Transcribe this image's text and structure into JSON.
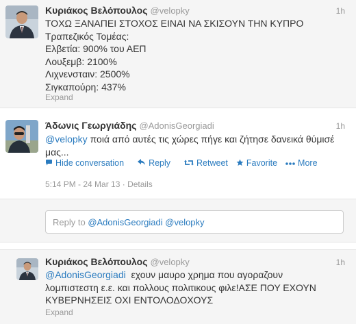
{
  "tweets": [
    {
      "name": "Κυριάκος Βελόπουλος",
      "handle": "@velopky",
      "time": "1h",
      "text": "ΤΟΧΩ ΞΑΝΑΠΕΙ ΣΤΟΧΟΣ ΕΙΝΑΙ ΝΑ ΣΚΙΣΟΥΝ ΤΗΝ ΚΥΠΡΟ\nΤραπεζικός Τομέας:\nΕλβετία: 900% του ΑΕΠ\nΛουξεμβ: 2100%\nΛιχνενσταιν: 2500%\nΣιγκαπούρη: 437%",
      "expand": "Expand"
    },
    {
      "name": "Άδωνις Γεωργιάδης",
      "handle": "@AdonisGeorgiadi",
      "time": "1h",
      "mention": "@velopky",
      "text": " ποιά από αυτές τις χώρες πήγε και ζήτησε δανεικά θύμισέ μας...",
      "actions": {
        "hide": "Hide conversation",
        "reply": "Reply",
        "retweet": "Retweet",
        "favorite": "Favorite",
        "more": "More"
      },
      "timestamp": "5:14 PM - 24 Mar 13",
      "details": "Details"
    },
    {
      "name": "Κυριάκος Βελόπουλος",
      "handle": "@velopky",
      "time": "1h",
      "mention": "@AdonisGeorgiadi",
      "text": "  εχουν μαυρο χρημα που αγοραζουν λομπιστεστη ε.ε. και πολλους πολιτικους φιλε!ΑΣΕ ΠΟΥ ΕΧΟΥΝ ΚΥΒΕΡΝΗΣΕΙΣ ΟΧΙ ΕΝΤΟΛΟΔΟΧΟΥΣ",
      "expand": "Expand"
    }
  ],
  "reply_box": {
    "prefix": "Reply to ",
    "mention1": "@AdonisGeorgiadi",
    "mention2": "@velopky"
  },
  "colors": {
    "link": "#2a7bbf",
    "muted": "#999999",
    "text": "#333333",
    "tweet_bg": "#f5f5f5"
  }
}
